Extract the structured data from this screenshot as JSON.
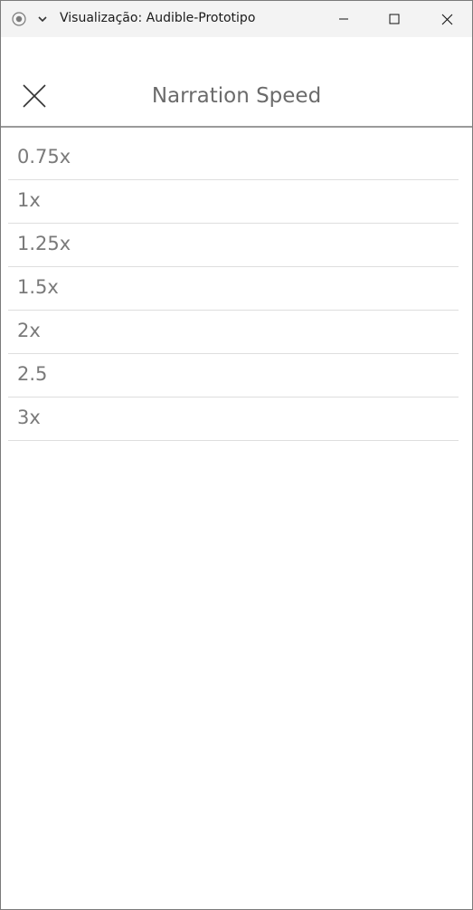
{
  "window": {
    "title": "Visualização: Audible-Prototipo",
    "icons": {
      "app": "app-record-icon",
      "menu": "chevron-down-icon",
      "minimize": "minimize-icon",
      "maximize": "maximize-icon",
      "close": "close-icon"
    }
  },
  "panel": {
    "title": "Narration Speed",
    "close_icon": "close-icon"
  },
  "speed_options": [
    {
      "label": "0.75x"
    },
    {
      "label": "1x"
    },
    {
      "label": "1.25x"
    },
    {
      "label": "1.5x"
    },
    {
      "label": "2x"
    },
    {
      "label": "2.5"
    },
    {
      "label": "3x"
    }
  ],
  "colors": {
    "titlebar_bg": "#f3f3f3",
    "title_text": "#6b6b6b",
    "item_text": "#7a7a7a",
    "divider": "#dedede"
  }
}
